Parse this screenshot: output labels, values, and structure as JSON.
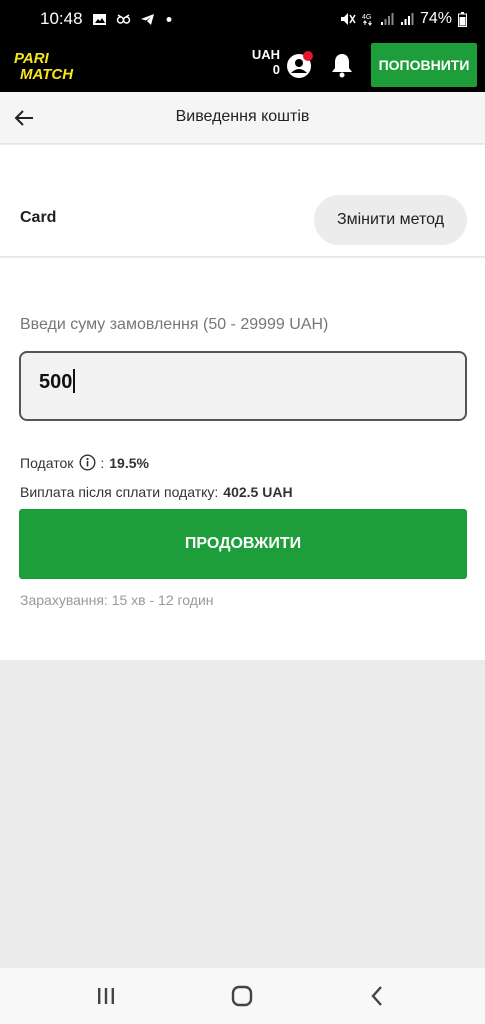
{
  "status_bar": {
    "time": "10:48",
    "battery": "74%",
    "icons": [
      "gallery-icon",
      "owl-icon",
      "telegram-icon",
      "dot-icon",
      "mute-icon",
      "network-4g-icon",
      "signal-icon",
      "signal-icon",
      "battery-icon"
    ],
    "network": "4G"
  },
  "header": {
    "logo_text": [
      "PARI",
      "MATCH"
    ],
    "currency": "UAH",
    "balance": "0",
    "deposit_label": "ПОПОВНИТИ",
    "colors": {
      "brand_yellow": "#f5e61c",
      "green": "#1e9e3a",
      "notification_dot": "#e5152b"
    }
  },
  "page": {
    "title": "Виведення коштів"
  },
  "method": {
    "name": "Card",
    "change_label": "Змінити метод"
  },
  "form": {
    "amount_label": "Введи суму замовлення (50 - 29999 UAH)",
    "amount_value": "500",
    "tax_label": "Податок",
    "tax_separator": ":",
    "tax_value": "19.5%",
    "payout_label": "Виплата після сплати податку:",
    "payout_value": "402.5 UAH",
    "continue_label": "ПРОДОВЖИТИ",
    "credit_note": "Зарахування: 15 хв - 12 годин"
  },
  "nav": {
    "icons": [
      "recent-apps-icon",
      "home-icon",
      "back-nav-icon"
    ]
  }
}
